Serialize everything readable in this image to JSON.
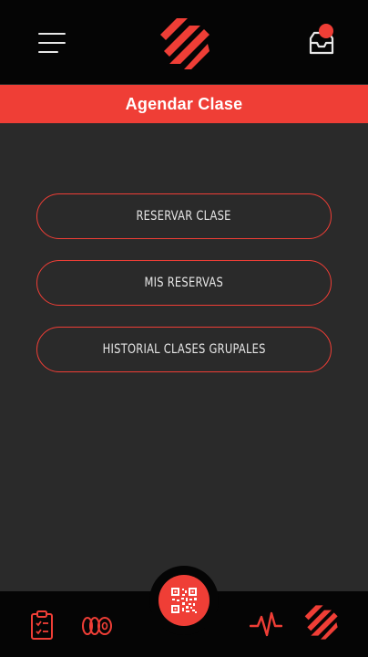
{
  "header": {
    "menu_icon": "hamburger-menu-icon",
    "logo_icon": "brand-logo",
    "inbox_icon": "inbox-icon",
    "has_notification": true
  },
  "page": {
    "title": "Agendar Clase"
  },
  "menu": {
    "items": [
      {
        "label": "RESERVAR CLASE"
      },
      {
        "label": "MIS RESERVAS"
      },
      {
        "label": "HISTORIAL CLASES GRUPALES"
      }
    ]
  },
  "bottom_nav": {
    "items": [
      {
        "icon": "clipboard-icon"
      },
      {
        "icon": "weight-plates-icon"
      },
      {
        "icon": "qr-code-icon"
      },
      {
        "icon": "heartbeat-icon"
      },
      {
        "icon": "brand-logo"
      }
    ]
  },
  "colors": {
    "accent": "#ef3e36",
    "background": "#2a2a2a",
    "bar": "#050505",
    "text": "#e6e6e6"
  }
}
